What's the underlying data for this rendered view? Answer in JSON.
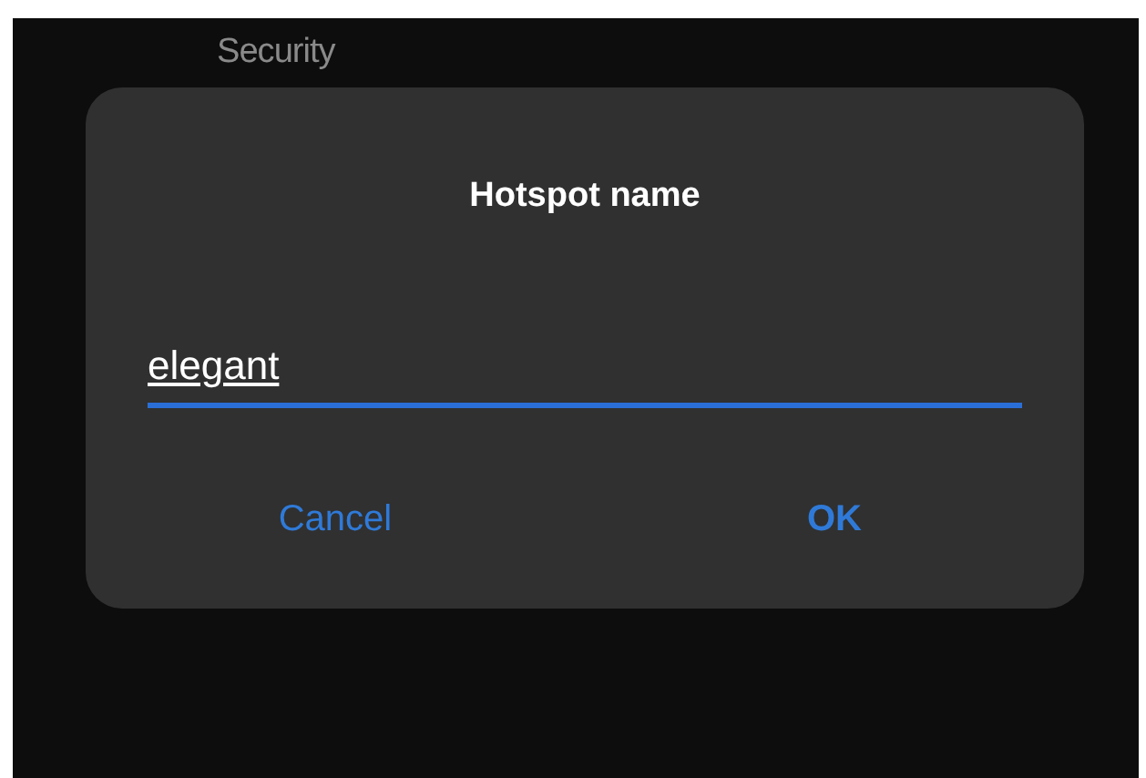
{
  "background_label": "Security",
  "dialog": {
    "title": "Hotspot name",
    "field": {
      "value": "elegant",
      "focused": true
    },
    "buttons": [
      {
        "label": "Cancel",
        "kind": "cancel"
      },
      {
        "label": "OK",
        "kind": "confirm"
      }
    ]
  }
}
